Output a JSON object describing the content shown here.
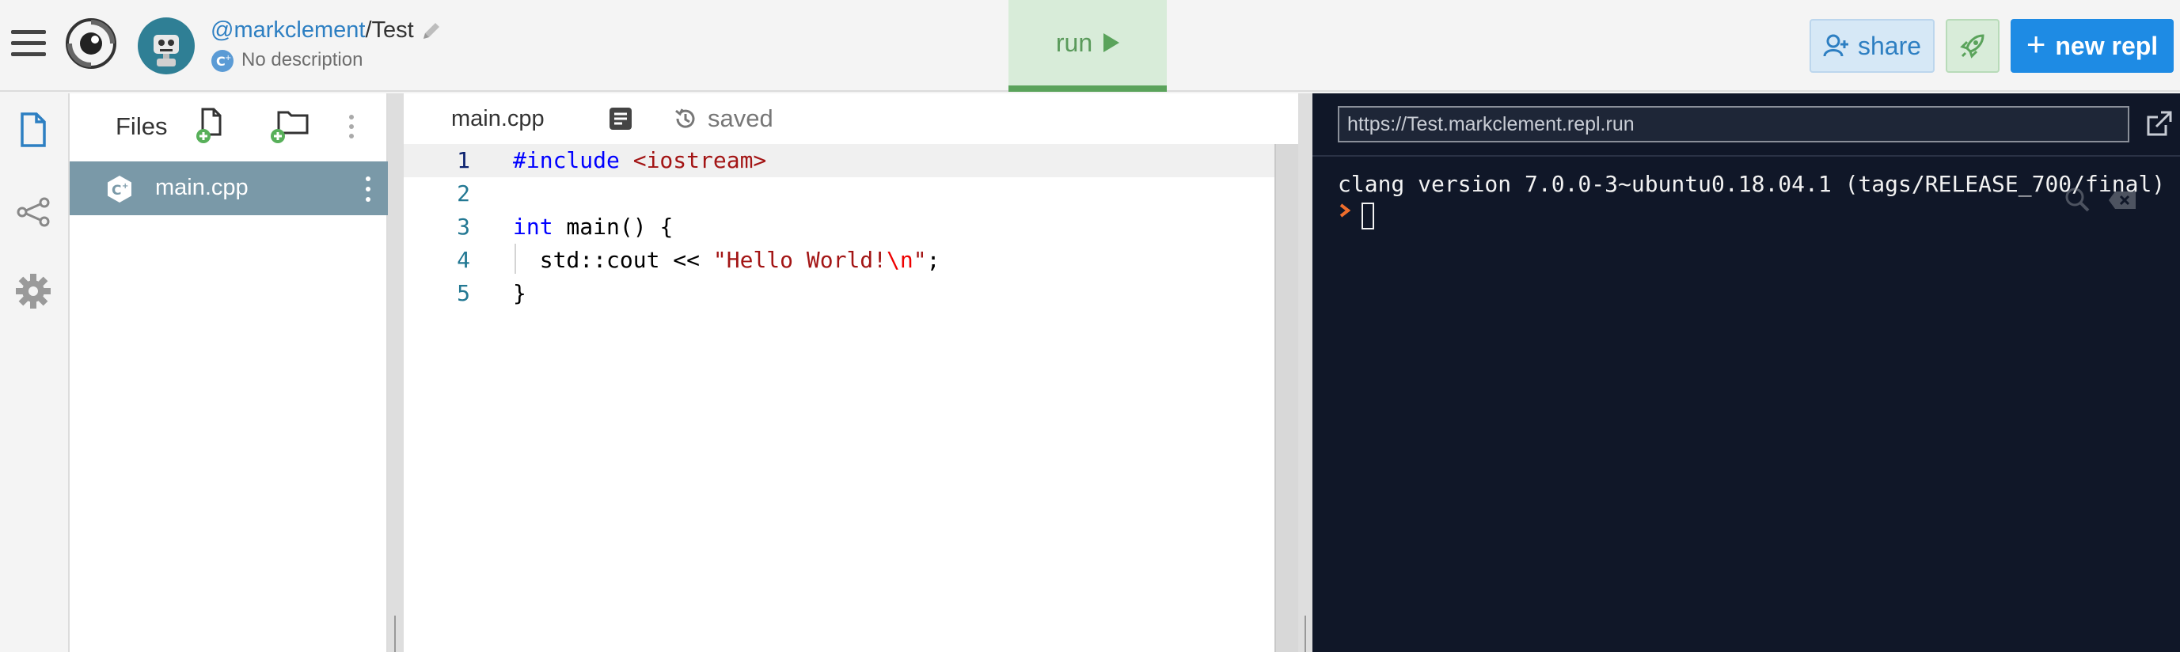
{
  "header": {
    "user": "@markclement",
    "separator": "/",
    "repl_name": "Test",
    "description": "No description",
    "run_label": "run",
    "share_label": "share",
    "new_repl_label": "new repl"
  },
  "icons": {
    "menu": "hamburger-icon",
    "logo": "repl-logo-icon",
    "edit": "pencil-icon",
    "run": "play-icon",
    "share": "add-user-icon",
    "deploy": "rocket-icon",
    "new": "plus-icon"
  },
  "sidebar": {
    "items": [
      {
        "name": "files",
        "icon": "file-icon"
      },
      {
        "name": "version-control",
        "icon": "share-nodes-icon"
      },
      {
        "name": "settings",
        "icon": "gear-icon"
      }
    ]
  },
  "files": {
    "title": "Files",
    "items": [
      {
        "name": "main.cpp",
        "selected": true
      }
    ]
  },
  "editor": {
    "tab": "main.cpp",
    "status": "saved",
    "lines": [
      {
        "n": "1",
        "parts": [
          {
            "t": "#include ",
            "c": "kw"
          },
          {
            "t": "<iostream>",
            "c": "inc"
          }
        ]
      },
      {
        "n": "2",
        "parts": []
      },
      {
        "n": "3",
        "parts": [
          {
            "t": "int",
            "c": "kw"
          },
          {
            "t": " main() {",
            "c": ""
          }
        ]
      },
      {
        "n": "4",
        "parts": [
          {
            "t": "  std::cout << ",
            "c": ""
          },
          {
            "t": "\"Hello World!",
            "c": "str"
          },
          {
            "t": "\\n",
            "c": "esc"
          },
          {
            "t": "\"",
            "c": "str"
          },
          {
            "t": ";",
            "c": ""
          }
        ]
      },
      {
        "n": "5",
        "parts": [
          {
            "t": "}",
            "c": ""
          }
        ]
      }
    ]
  },
  "console": {
    "url": "https://Test.markclement.repl.run",
    "output": "clang version 7.0.0-3~ubuntu0.18.04.1 (tags/RELEASE_700/final)"
  },
  "colors": {
    "accent_blue": "#1e8be4",
    "run_green": "#5aa35b",
    "console_bg": "#101728",
    "selected_file": "#7a99a8"
  }
}
